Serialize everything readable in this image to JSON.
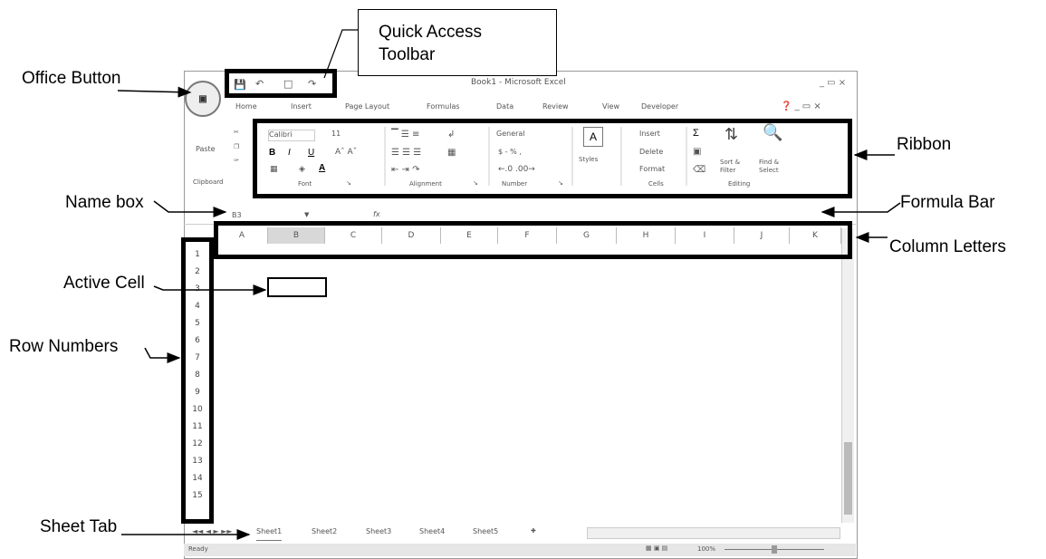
{
  "callouts": {
    "quick_access": [
      "Quick Access",
      "Toolbar"
    ],
    "office_button": "Office Button",
    "ribbon": "Ribbon",
    "name_box": "Name box",
    "formula_bar": "Formula Bar",
    "column_letters": "Column Letters",
    "active_cell": "Active Cell",
    "row_numbers": "Row Numbers",
    "sheet_tab": "Sheet Tab"
  },
  "window": {
    "title": "Book1 - Microsoft Excel",
    "menu_tabs": [
      "Home",
      "Insert",
      "Page Layout",
      "Formulas",
      "Data",
      "Review",
      "View",
      "Developer"
    ],
    "ribbon": {
      "clipboard": {
        "paste": "Paste",
        "group": "Clipboard"
      },
      "font": {
        "name": "Calibri",
        "size": "11",
        "group": "Font"
      },
      "alignment": {
        "group": "Alignment"
      },
      "number": {
        "format": "General",
        "symbols": "$ - % ,",
        "group": "Number"
      },
      "styles": {
        "label": "Styles"
      },
      "cells": {
        "insert": "Insert",
        "delete": "Delete",
        "format": "Format",
        "group": "Cells"
      },
      "editing": {
        "sort": "Sort &",
        "filter": "Filter",
        "find": "Find &",
        "select": "Select",
        "group": "Editing"
      }
    },
    "name_box": "B3",
    "fx": "fx",
    "columns": [
      "A",
      "B",
      "C",
      "D",
      "E",
      "F",
      "G",
      "H",
      "I",
      "J",
      "K"
    ],
    "rows": [
      "1",
      "2",
      "3",
      "4",
      "5",
      "6",
      "7",
      "8",
      "9",
      "10",
      "11",
      "12",
      "13",
      "14",
      "15"
    ],
    "sheets": [
      "Sheet1",
      "Sheet2",
      "Sheet3",
      "Sheet4",
      "Sheet5"
    ],
    "status": {
      "ready": "Ready",
      "zoom": "100%"
    }
  }
}
